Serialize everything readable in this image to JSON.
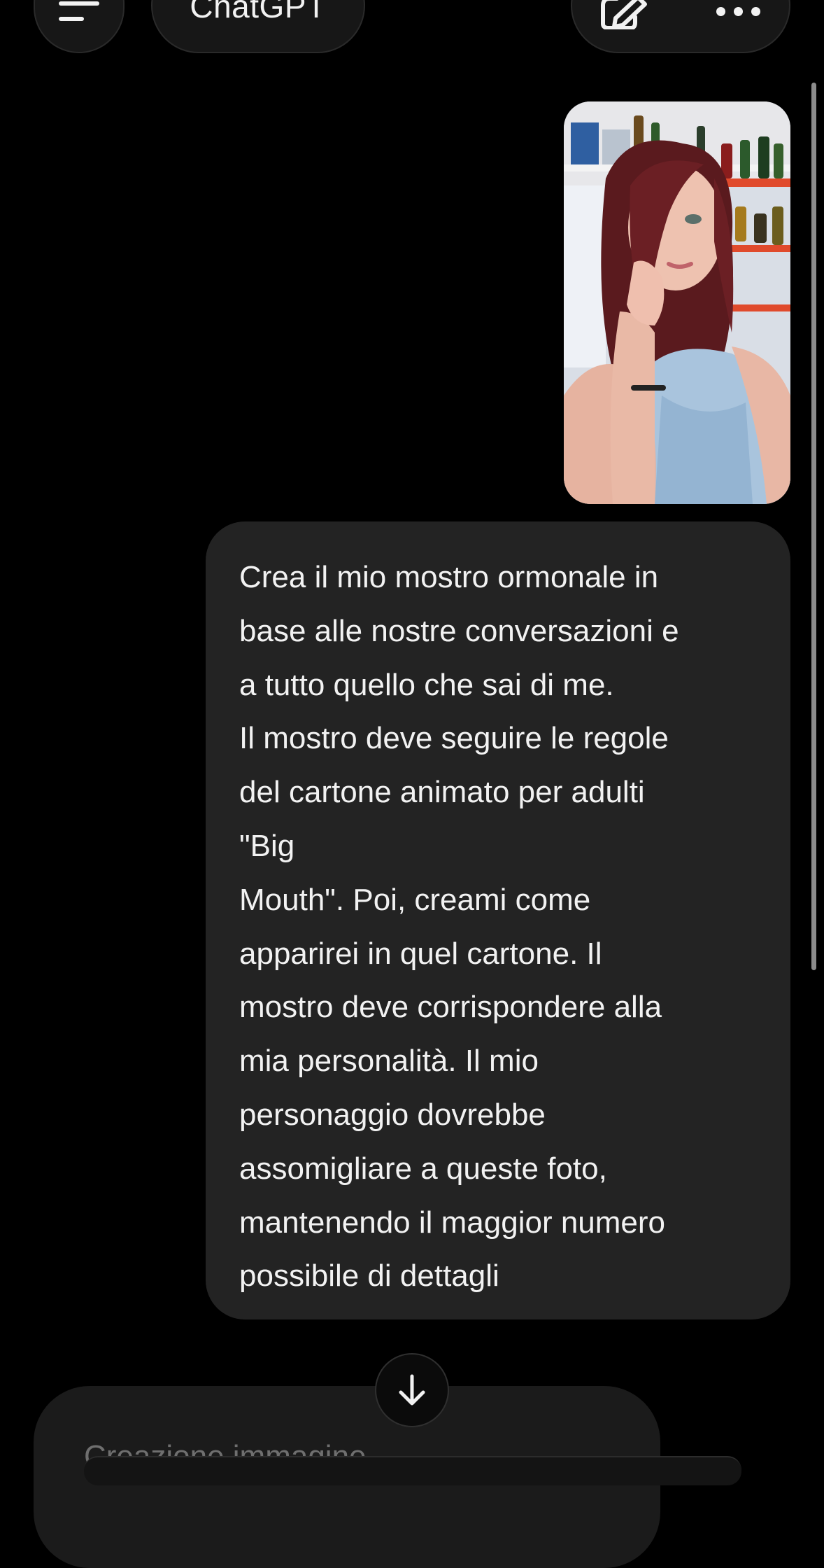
{
  "header": {
    "title": "ChatGPT",
    "menu_icon": "hamburger-menu-icon",
    "edit_icon": "new-chat-edit-icon",
    "more_icon": "more-dots-icon"
  },
  "photo": {
    "description_icon": "attached-photo"
  },
  "message": {
    "lines": [
      "Crea il mio mostro ormonale in",
      "base alle nostre conversazioni e",
      "a tutto quello che sai di me.",
      "Il mostro deve seguire le regole",
      "del cartone animato per adulti",
      "\"Big",
      "Mouth\". Poi, creami come",
      "apparirei in quel cartone. Il",
      "mostro deve corrispondere alla",
      "mia personalità. Il mio",
      "personaggio dovrebbe",
      "assomigliare a queste foto,",
      "mantenendo il maggior numero",
      "possibile di dettagli"
    ]
  },
  "scroll_down_icon": "arrow-down-icon",
  "status": {
    "label": "Creazione immagine"
  },
  "colors": {
    "background": "#000000",
    "bubble": "#232323",
    "text": "#f2f2f2"
  }
}
